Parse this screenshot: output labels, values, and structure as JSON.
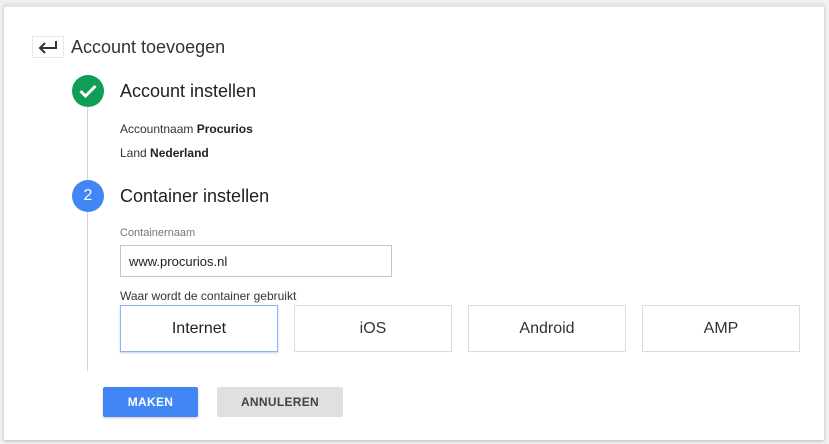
{
  "header": {
    "title": "Account toevoegen",
    "back_icon": "arrow-back-icon"
  },
  "step1": {
    "status_icon": "check-icon",
    "title": "Account instellen",
    "account_label": "Accountnaam",
    "account_value": "Procurios",
    "country_label": "Land",
    "country_value": "Nederland"
  },
  "step2": {
    "number": "2",
    "title": "Container instellen",
    "container_name_label": "Containernaam",
    "container_name_value": "www.procurios.nl",
    "usage_label": "Waar wordt de container gebruikt",
    "platforms": [
      "Internet",
      "iOS",
      "Android",
      "AMP"
    ],
    "selected_platform": "Internet"
  },
  "actions": {
    "create_label": "MAKEN",
    "cancel_label": "ANNULEREN"
  },
  "colors": {
    "success": "#0f9d58",
    "primary": "#4285f4",
    "secondary": "#e0e0e0"
  }
}
